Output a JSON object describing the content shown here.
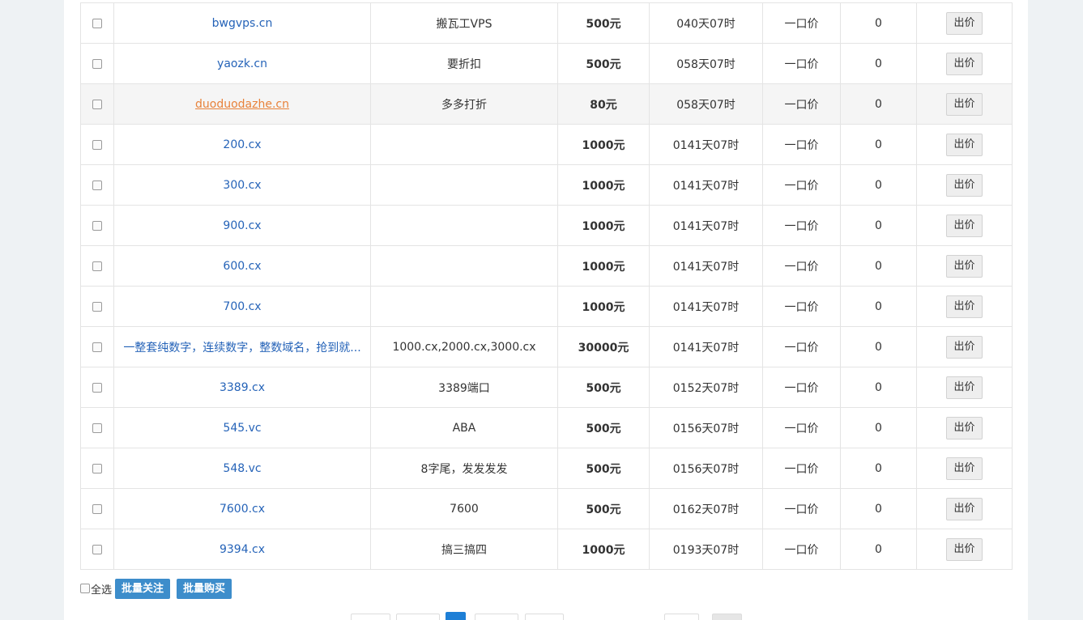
{
  "rows": [
    {
      "domain": "bwgvps.cn",
      "desc": "搬瓦工VPS",
      "price": "500元",
      "time": "040天07时",
      "type": "一口价",
      "bids": "0"
    },
    {
      "domain": "yaozk.cn",
      "desc": "要折扣",
      "price": "500元",
      "time": "058天07时",
      "type": "一口价",
      "bids": "0"
    },
    {
      "domain": "duoduodazhe.cn",
      "desc": "多多打折",
      "price": "80元",
      "time": "058天07时",
      "type": "一口价",
      "bids": "0"
    },
    {
      "domain": "200.cx",
      "desc": "",
      "price": "1000元",
      "time": "0141天07时",
      "type": "一口价",
      "bids": "0"
    },
    {
      "domain": "300.cx",
      "desc": "",
      "price": "1000元",
      "time": "0141天07时",
      "type": "一口价",
      "bids": "0"
    },
    {
      "domain": "900.cx",
      "desc": "",
      "price": "1000元",
      "time": "0141天07时",
      "type": "一口价",
      "bids": "0"
    },
    {
      "domain": "600.cx",
      "desc": "",
      "price": "1000元",
      "time": "0141天07时",
      "type": "一口价",
      "bids": "0"
    },
    {
      "domain": "700.cx",
      "desc": "",
      "price": "1000元",
      "time": "0141天07时",
      "type": "一口价",
      "bids": "0"
    },
    {
      "domain": "一整套纯数字，连续数字，整数域名，抢到就...",
      "desc": "1000.cx,2000.cx,3000.cx",
      "price": "30000元",
      "time": "0141天07时",
      "type": "一口价",
      "bids": "0"
    },
    {
      "domain": "3389.cx",
      "desc": "3389端口",
      "price": "500元",
      "time": "0152天07时",
      "type": "一口价",
      "bids": "0"
    },
    {
      "domain": "545.vc",
      "desc": "ABA",
      "price": "500元",
      "time": "0156天07时",
      "type": "一口价",
      "bids": "0"
    },
    {
      "domain": "548.vc",
      "desc": "8字尾，发发发发",
      "price": "500元",
      "time": "0156天07时",
      "type": "一口价",
      "bids": "0"
    },
    {
      "domain": "7600.cx",
      "desc": "7600",
      "price": "500元",
      "time": "0162天07时",
      "type": "一口价",
      "bids": "0"
    },
    {
      "domain": "9394.cx",
      "desc": "搞三搞四",
      "price": "1000元",
      "time": "0193天07时",
      "type": "一口价",
      "bids": "0"
    }
  ],
  "bid_label": "出价",
  "hover_row": 2,
  "footer": {
    "select_all": "全选",
    "batch_follow": "批量关注",
    "batch_buy": "批量购买"
  },
  "colors": {
    "link": "#2563b8",
    "link_active": "#e8823a",
    "primary_button": "#3d8dcb",
    "pager_current": "#1e7fd6"
  }
}
